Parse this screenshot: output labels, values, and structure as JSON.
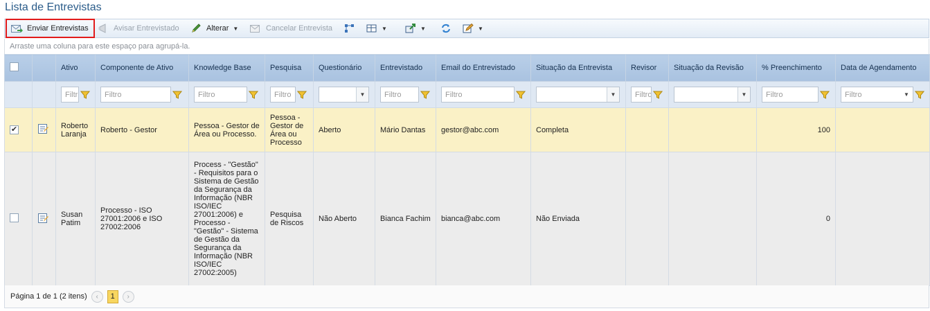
{
  "page": {
    "title": "Lista de Entrevistas"
  },
  "toolbar": {
    "send": "Enviar Entrevistas",
    "notify": "Avisar Entrevistado",
    "edit": "Alterar",
    "cancel": "Cancelar Entrevista"
  },
  "group_panel": "Arraste uma coluna para este espaço para agrupá-la.",
  "columns": {
    "ativo": "Ativo",
    "componente": "Componente de Ativo",
    "kb": "Knowledge Base",
    "pesquisa": "Pesquisa",
    "questionario": "Questionário",
    "entrevistado": "Entrevistado",
    "email": "Email do Entrevistado",
    "situacao": "Situação da Entrevista",
    "revisor": "Revisor",
    "situacao_revisao": "Situação da Revisão",
    "preenchimento": "% Preenchimento",
    "agendamento": "Data de Agendamento"
  },
  "filters": {
    "placeholder": "Filtro",
    "short": "Filtr",
    "short2": "Filtro"
  },
  "rows": [
    {
      "checked": true,
      "ativo": "Roberto Laranja",
      "componente": "Roberto - Gestor",
      "kb": "Pessoa - Gestor de Área ou Processo.",
      "pesquisa": "Pessoa - Gestor de Área ou Processo",
      "questionario": "Aberto",
      "entrevistado": "Mário Dantas",
      "email": "gestor@abc.com",
      "situacao": "Completa",
      "revisor": "",
      "situacao_revisao": "",
      "preenchimento": "100",
      "agendamento": ""
    },
    {
      "checked": false,
      "ativo": "Susan Patim",
      "componente": "Processo - ISO 27001:2006 e ISO 27002:2006",
      "kb": "Process - \"Gestão\" - Requisitos para o Sistema de Gestão da Segurança da Informação (NBR ISO/IEC 27001:2006) e Processo - \"Gestão\" - Sistema de Gestão da Segurança da Informação (NBR ISO/IEC 27002:2005)",
      "pesquisa": "Pesquisa de Riscos",
      "questionario": "Não Aberto",
      "entrevistado": "Bianca Fachim",
      "email": "bianca@abc.com",
      "situacao": "Não Enviada",
      "revisor": "",
      "situacao_revisao": "",
      "preenchimento": "0",
      "agendamento": ""
    }
  ],
  "pager": {
    "summary": "Página 1 de 1 (2 itens)",
    "current": "1",
    "prev": "‹",
    "next": "›"
  },
  "colors": {
    "highlight": "#e21b1b",
    "header": "#b9cfe8",
    "selected_row": "#faf1c6",
    "title": "#2b5c8a"
  }
}
